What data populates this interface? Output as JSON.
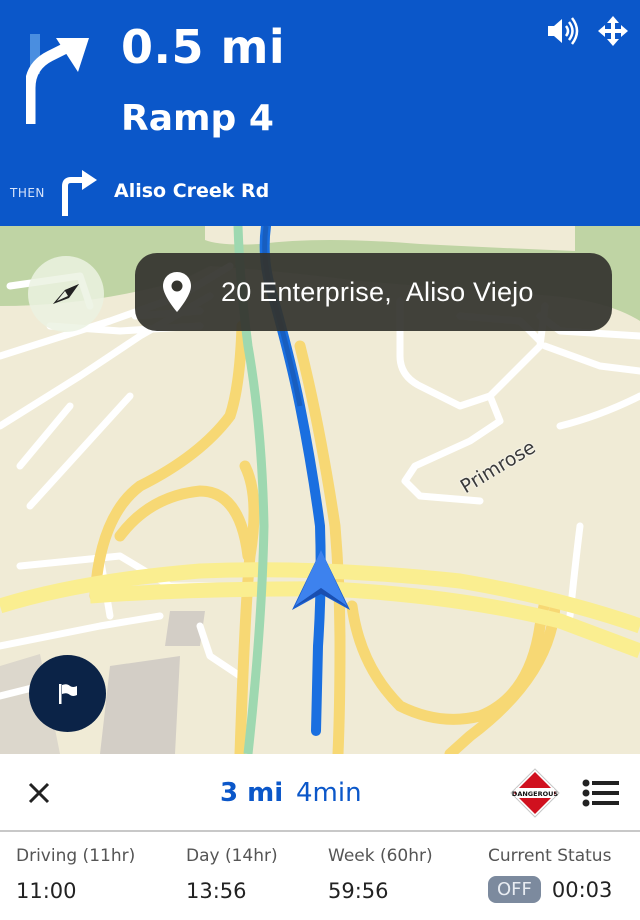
{
  "header": {
    "distance": "0.5 mi",
    "road_name": "Ramp 4",
    "maneuver_icon": "bear-right-arrow-icon",
    "then_label": "THEN",
    "then_icon": "turn-right-arrow-icon",
    "then_road": "Aliso Creek Rd",
    "sound_icon": "volume-icon",
    "move_icon": "move-arrows-icon",
    "background_color": "#0b57c9"
  },
  "map": {
    "compass_icon": "compass-icon",
    "destination": {
      "icon": "location-pin-icon",
      "text": "20 Enterprise,  Aliso Viejo"
    },
    "street_labels": [
      "Primrose"
    ],
    "vehicle_icon": "navigation-arrow-icon",
    "report_icon": "flag-icon",
    "route_color": "#1a6fe0"
  },
  "route_summary": {
    "close_icon": "close-icon",
    "distance": "3 mi",
    "duration": "4min",
    "hazmat_label": "DANGEROUS",
    "hazmat_icon": "hazmat-placard-icon",
    "list_icon": "list-icon"
  },
  "hos": {
    "columns": [
      {
        "label": "Driving (11hr)",
        "value": "11:00"
      },
      {
        "label": "Day (14hr)",
        "value": "13:56"
      },
      {
        "label": "Week (60hr)",
        "value": "59:56"
      }
    ],
    "current_status": {
      "label": "Current Status",
      "badge": "OFF",
      "time": "00:03"
    }
  }
}
